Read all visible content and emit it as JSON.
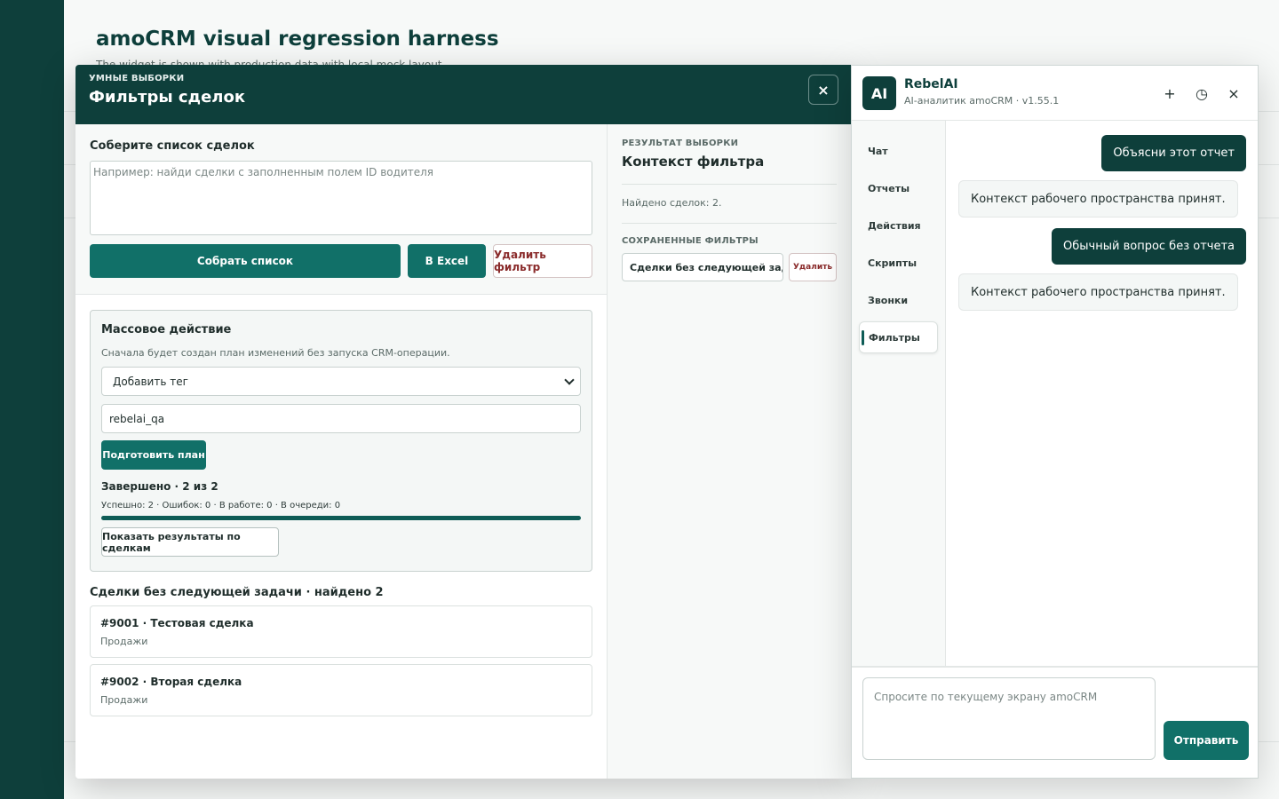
{
  "background": {
    "title": "amoCRM visual regression harness",
    "subtitle": "The widget is shown with production data with local mock layout"
  },
  "modal": {
    "eyebrow": "УМНЫЕ ВЫБОРКИ",
    "title": "Фильтры сделок",
    "close_icon": "×",
    "compose": {
      "title": "Соберите список сделок",
      "placeholder": "Например: найди сделки с заполненным полем ID водителя",
      "collect_label": "Собрать список",
      "excel_label": "В Excel",
      "delete_label": "Удалить фильтр"
    },
    "mass": {
      "title": "Массовое действие",
      "desc": "Сначала будет создан план изменений без запуска CRM-операции.",
      "action_selected": "Добавить тег",
      "tag_value": "rebelai_qa",
      "plan_label": "Подготовить план",
      "done_title": "Завершено · 2 из 2",
      "stats": "Успешно: 2 · Ошибок: 0 · В работе: 0 · В очереди: 0",
      "progress": 1.0,
      "results_label": "Показать результаты по сделкам"
    },
    "deals_title": "Сделки без следующей задачи · найдено 2",
    "deals": [
      {
        "name": "#9001 · Тестовая сделка",
        "pipeline": "Продажи"
      },
      {
        "name": "#9002 · Вторая сделка",
        "pipeline": "Продажи"
      }
    ],
    "result": {
      "eyebrow": "РЕЗУЛЬТАТ ВЫБОРКИ",
      "title": "Контекст фильтра",
      "found": "Найдено сделок: 2.",
      "saved_eyebrow": "СОХРАНЕННЫЕ ФИЛЬТРЫ",
      "saved_filter": "Сделки без следующей зада...",
      "saved_delete": "Удалить"
    }
  },
  "ai": {
    "logo": "AI",
    "name": "RebelAI",
    "version": "AI-аналитик amoCRM · v1.55.1",
    "add_icon": "+",
    "history_icon": "◷",
    "close_icon": "×",
    "nav": [
      "Чат",
      "Отчеты",
      "Действия",
      "Скрипты",
      "Звонки",
      "Фильтры"
    ],
    "messages": [
      {
        "role": "user",
        "text": "Объясни этот отчет"
      },
      {
        "role": "bot",
        "text": "Контекст рабочего пространства принят."
      },
      {
        "role": "user",
        "text": "Обычный вопрос без отчета"
      },
      {
        "role": "bot",
        "text": "Контекст рабочего пространства принят."
      }
    ],
    "input_placeholder": "Спросите по текущему экрану amoCRM",
    "send_label": "Отправить"
  }
}
